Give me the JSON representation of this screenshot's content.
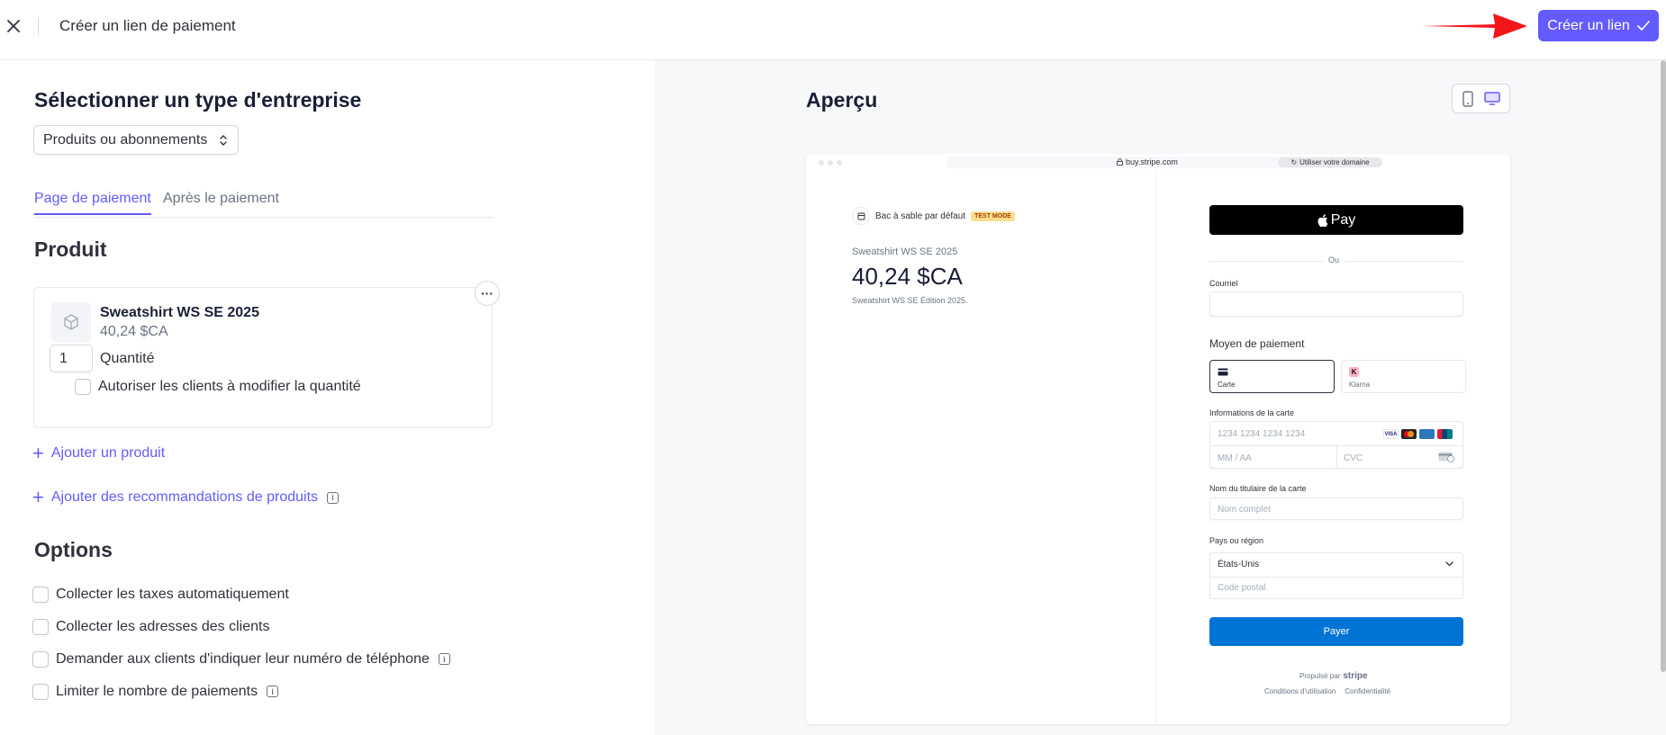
{
  "topbar": {
    "title": "Créer un lien de paiement",
    "create_label": "Créer un lien",
    "accent": "#635bff"
  },
  "left": {
    "business_type_title": "Sélectionner un type d'entreprise",
    "business_type_value": "Produits ou abonnements",
    "tabs": [
      {
        "label": "Page de paiement",
        "active": true
      },
      {
        "label": "Après le paiement",
        "active": false
      }
    ],
    "product_section_title": "Produit",
    "product": {
      "name": "Sweatshirt WS SE 2025",
      "price": "40,24 $CA",
      "quantity": "1",
      "quantity_label": "Quantité",
      "allow_adjust_label": "Autoriser les clients à modifier la quantité"
    },
    "add_product_label": "Ajouter un produit",
    "add_recommendations_label": "Ajouter des recommandations de produits",
    "options_title": "Options",
    "options": [
      {
        "label": "Collecter les taxes automatiquement",
        "info": false
      },
      {
        "label": "Collecter les adresses des clients",
        "info": false
      },
      {
        "label": "Demander aux clients d'indiquer leur numéro de téléphone",
        "info": true
      },
      {
        "label": "Limiter le nombre de paiements",
        "info": true
      }
    ]
  },
  "preview": {
    "title": "Aperçu",
    "url": "buy.stripe.com",
    "use_domain_label": "Utiliser votre domaine",
    "sandbox_label": "Bac à sable par défaut",
    "test_mode_label": "TEST MODE",
    "product_name": "Sweatshirt WS SE 2025",
    "price": "40,24 $CA",
    "description": "Sweatshirt WS SE Édition 2025.",
    "apple_pay_label": "Pay",
    "or_label": "Ou",
    "email_label": "Courriel",
    "payment_method_title": "Moyen de paiement",
    "methods": [
      {
        "label": "Carte",
        "selected": true
      },
      {
        "label": "Klarna",
        "selected": false
      }
    ],
    "card_info_label": "Informations de la carte",
    "card_number_placeholder": "1234 1234 1234 1234",
    "expiry_placeholder": "MM / AA",
    "cvc_placeholder": "CVC",
    "cardholder_label": "Nom du titulaire de la carte",
    "cardholder_placeholder": "Nom complet",
    "country_label": "Pays ou région",
    "country_value": "États-Unis",
    "postal_placeholder": "Code postal",
    "pay_label": "Payer",
    "powered_by_label": "Propulsé par",
    "powered_by_brand": "stripe",
    "terms_label": "Conditions d'utilisation",
    "privacy_label": "Confidentialité",
    "pay_color": "#0074d4"
  }
}
